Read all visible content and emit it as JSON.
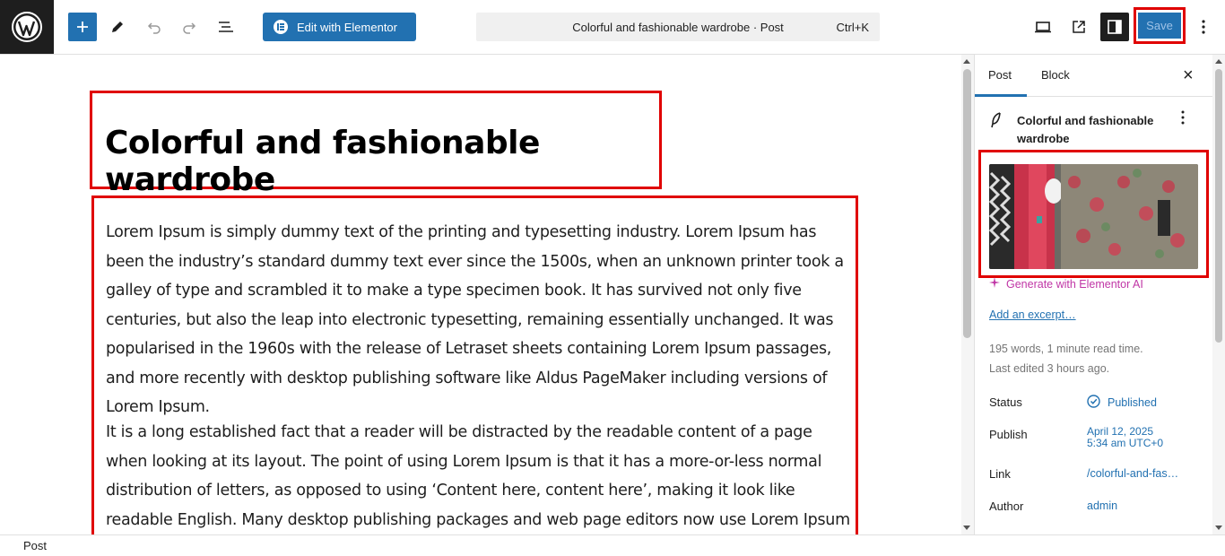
{
  "toolbar": {
    "logo_icon": "wordpress-logo",
    "add_icon": "plus-icon",
    "tools_icon": "pencil-icon",
    "undo_icon": "undo-icon",
    "redo_icon": "redo-icon",
    "outline_icon": "list-view-icon",
    "elementor_label": "Edit with Elementor",
    "command_title": "Colorful and fashionable wardrobe · Post",
    "command_shortcut": "Ctrl+K",
    "view_icon": "desktop-icon",
    "preview_icon": "external-link-icon",
    "settings_icon": "sidebar-toggle-icon",
    "save_label": "Save",
    "more_icon": "vertical-ellipsis-icon"
  },
  "editor": {
    "title": "Colorful and fashionable wardrobe",
    "paragraphs": [
      "Lorem Ipsum is simply dummy text of the printing and typesetting industry. Lorem Ipsum has been the industry’s standard dummy text ever since the 1500s, when an unknown printer took a galley of type and scrambled it to make a type specimen book. It has survived not only five centuries, but also the leap into electronic typesetting, remaining essentially unchanged. It was popularised in the 1960s with the release of Letraset sheets containing Lorem Ipsum passages, and more recently with desktop publishing software like Aldus PageMaker including versions of Lorem Ipsum.",
      "It is a long established fact that a reader will be distracted by the readable content of a page when looking at its layout. The point of using Lorem Ipsum is that it has a more-or-less normal distribution of letters, as opposed to using ‘Content here, content here’, making it look like readable English. Many desktop publishing packages and web page editors now use Lorem Ipsum as their default model text,"
    ]
  },
  "sidebar": {
    "tab_post": "Post",
    "tab_block": "Block",
    "close_label": "×",
    "doc_title": "Colorful and fashionable wardrobe",
    "generate_ai": "Generate with Elementor AI",
    "add_excerpt": "Add an excerpt…",
    "word_count": "195 words, 1 minute read time.",
    "last_edited": "Last edited 3 hours ago.",
    "rows": {
      "status_label": "Status",
      "status_value": "Published",
      "publish_label": "Publish",
      "publish_date": "April 12, 2025",
      "publish_time": "5:34 am UTC+0",
      "link_label": "Link",
      "link_value": "/colorful-and-fas…",
      "author_label": "Author",
      "author_value": "admin"
    }
  },
  "footer": {
    "breadcrumb": "Post"
  },
  "colors": {
    "accent": "#2271b1",
    "highlight": "#e00000",
    "ai": "#c036a6"
  }
}
